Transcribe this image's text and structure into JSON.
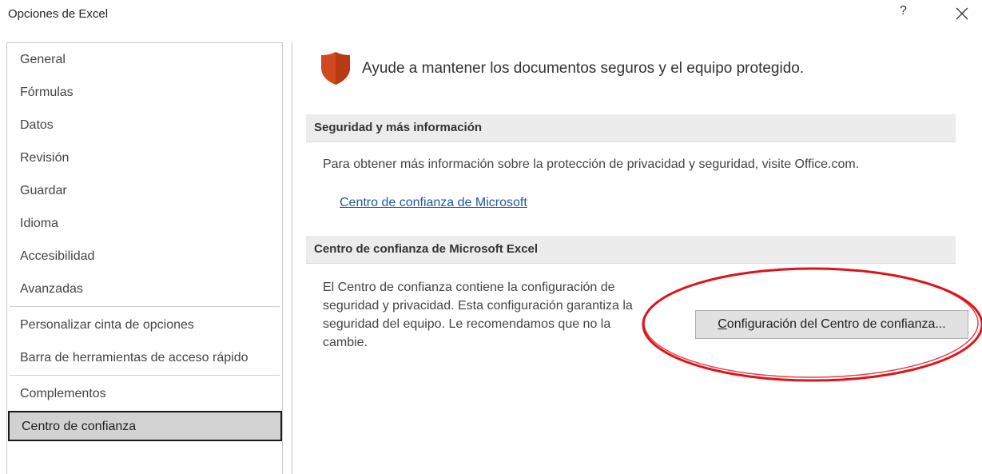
{
  "window": {
    "title": "Opciones de Excel",
    "help_glyph": "?",
    "close_icon": "close-icon"
  },
  "sidebar": {
    "items": [
      {
        "label": "General"
      },
      {
        "label": "Fórmulas"
      },
      {
        "label": "Datos"
      },
      {
        "label": "Revisión"
      },
      {
        "label": "Guardar"
      },
      {
        "label": "Idioma"
      },
      {
        "label": "Accesibilidad"
      },
      {
        "label": "Avanzadas"
      },
      {
        "label": "Personalizar cinta de opciones"
      },
      {
        "label": "Barra de herramientas de acceso rápido"
      },
      {
        "label": "Complementos"
      },
      {
        "label": "Centro de confianza",
        "selected": true
      }
    ]
  },
  "main": {
    "headline": "Ayude a mantener los documentos seguros y el equipo protegido.",
    "headline_icon": "shield-icon",
    "security_section": {
      "header": "Seguridad y más información",
      "text": "Para obtener más información sobre la protección de privacidad y seguridad, visite Office.com.",
      "link": "Centro de confianza de Microsoft"
    },
    "trust_section": {
      "header": "Centro de confianza de Microsoft Excel",
      "description_lines": [
        "El Centro de confianza contiene la configuración de",
        "seguridad y privacidad. Esta configuración garantiza la",
        "seguridad del equipo. Le recomendamos que no la",
        "cambie."
      ],
      "button_mnemonic": "C",
      "button_rest": "onfiguración del Centro de confianza..."
    }
  },
  "colors": {
    "shield": "#d04a1f",
    "link": "#1f5aa5",
    "annotation": "#e0121b",
    "selected_bg": "#d2d2d2",
    "section_bg": "#ececec"
  }
}
